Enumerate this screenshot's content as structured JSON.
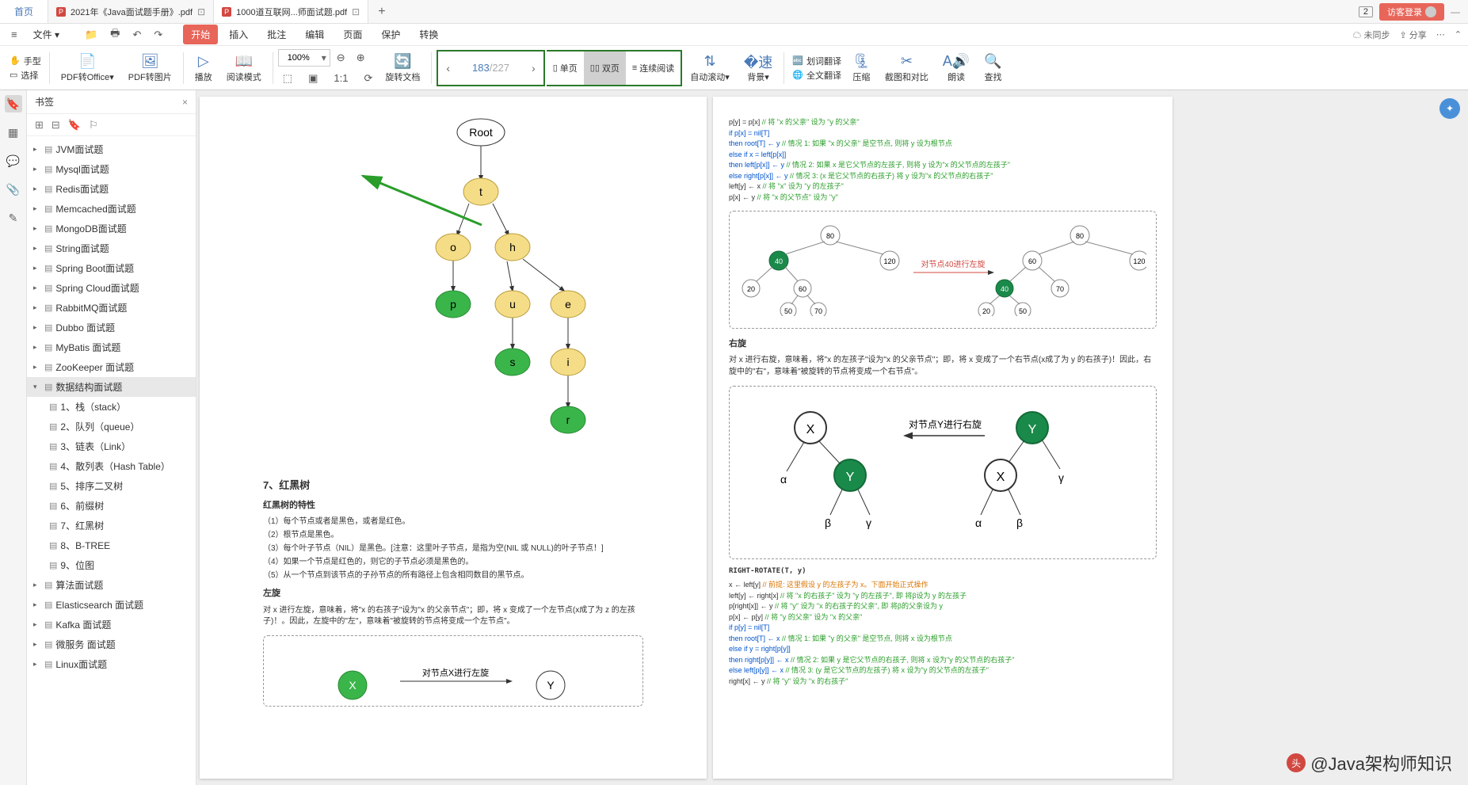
{
  "title_bar": {
    "home": "首页",
    "tabs": [
      {
        "label": "2021年《Java面试题手册》.pdf",
        "badge": "P"
      },
      {
        "label": "1000道互联网...师面试题.pdf",
        "badge": "P"
      }
    ],
    "badge_num": "2",
    "login": "访客登录"
  },
  "menu": {
    "file": "文件",
    "items": [
      "开始",
      "插入",
      "批注",
      "编辑",
      "页面",
      "保护",
      "转换"
    ],
    "right": {
      "unsync": "未同步",
      "share": "分享"
    }
  },
  "toolbar": {
    "hand": "手型",
    "select": "选择",
    "pdf_office": "PDF转Office",
    "pdf_img": "PDF转图片",
    "play": "播放",
    "read_mode": "阅读模式",
    "zoom": "100%",
    "rotate": "旋转文档",
    "page_cur": "183",
    "page_total": "/227",
    "single": "单页",
    "double": "双页",
    "continuous": "连续阅读",
    "auto_scroll": "自动滚动",
    "bg": "背景",
    "word_trans": "划词翻译",
    "full_trans": "全文翻译",
    "compress": "压缩",
    "screenshot": "截图和对比",
    "read_aloud": "朗读",
    "find": "查找"
  },
  "sidebar": {
    "title": "书签",
    "items": [
      {
        "label": "JVM面试题"
      },
      {
        "label": "Mysql面试题"
      },
      {
        "label": "Redis面试题"
      },
      {
        "label": "Memcached面试题"
      },
      {
        "label": "MongoDB面试题"
      },
      {
        "label": "String面试题"
      },
      {
        "label": "Spring Boot面试题"
      },
      {
        "label": "Spring Cloud面试题"
      },
      {
        "label": "RabbitMQ面试题"
      },
      {
        "label": "Dubbo 面试题"
      },
      {
        "label": "MyBatis 面试题"
      },
      {
        "label": "ZooKeeper 面试题"
      },
      {
        "label": "数据结构面试题",
        "selected": true,
        "expanded": true,
        "children": [
          "1、栈（stack）",
          "2、队列（queue）",
          "3、链表（Link）",
          "4、散列表（Hash Table）",
          "5、排序二叉树",
          "6、前缀树",
          "7、红黑树",
          "8、B-TREE",
          "9、位图"
        ]
      },
      {
        "label": "算法面试题"
      },
      {
        "label": "Elasticsearch 面试题"
      },
      {
        "label": "Kafka 面试题"
      },
      {
        "label": "微服务 面试题"
      },
      {
        "label": "Linux面试题"
      }
    ]
  },
  "left_page": {
    "tree": {
      "root": "Root",
      "nodes": [
        "t",
        "o",
        "h",
        "p",
        "u",
        "e",
        "s",
        "i",
        "r"
      ]
    },
    "section": "7、红黑树",
    "subtitle": "红黑树的特性",
    "lines": [
      "（1）每个节点或者是黑色，或者是红色。",
      "（2）根节点是黑色。",
      "（3）每个叶子节点（NIL）是黑色。[注意：这里叶子节点，是指为空(NIL 或 NULL)的叶子节点！]",
      "（4）如果一个节点是红色的，则它的子节点必须是黑色的。",
      "（5）从一个节点到该节点的子孙节点的所有路径上包含相同数目的黑节点。"
    ],
    "leftrot_title": "左旋",
    "leftrot_text": "对 x 进行左旋，意味着，将\"x 的右孩子\"设为\"x 的父亲节点\"；即，将 x 变成了一个左节点(x成了为 z 的左孩子)！。因此，左旋中的\"左\"，意味着\"被旋转的节点将变成一个左节点\"。",
    "leftrot_diag": "对节点X进行左旋"
  },
  "right_page": {
    "code1": [
      {
        "t": "p[y] = p[x]",
        "c": ""
      },
      {
        "t": " // 将 \"x 的父亲\" 设为 \"y 的父亲\"",
        "c": "kw-green"
      },
      {
        "t": "if p[x] = nil[T]",
        "c": "kw-blue"
      },
      {
        "t": "then root[T] ← y",
        "c": "kw-blue"
      },
      {
        "t": " // 情况 1: 如果 \"x 的父亲\" 是空节点, 则将 y 设为根节点",
        "c": "kw-green"
      },
      {
        "t": "else if x = left[p[x]]",
        "c": "kw-blue"
      },
      {
        "t": "then left[p[x]] ← y",
        "c": "kw-blue"
      },
      {
        "t": " // 情况 2: 如果 x 是它父节点的左孩子, 则将 y 设为\"x 的父节点的左孩子\"",
        "c": "kw-green"
      },
      {
        "t": "else right[p[x]] ← y",
        "c": "kw-blue"
      },
      {
        "t": " // 情况 3: (x 是它父节点的右孩子) 将 y 设为\"x 的父节点的右孩子\"",
        "c": "kw-green"
      },
      {
        "t": "left[y] ← x",
        "c": ""
      },
      {
        "t": " // 将 \"x\" 设为 \"y 的左孩子\"",
        "c": "kw-green"
      },
      {
        "t": "p[x] ← y",
        "c": ""
      },
      {
        "t": " // 将 \"x 的父节点\" 设为 \"y\"",
        "c": "kw-green"
      }
    ],
    "bst_label": "对节点40进行左旋",
    "rightrot_title": "右旋",
    "rightrot_text": "对 x 进行右旋，意味着，将\"x 的左孩子\"设为\"x 的父亲节点\"；即，将 x 变成了一个右节点(x成了为 y 的右孩子)！因此，右旋中的\"右\"，意味着\"被旋转的节点将变成一个右节点\"。",
    "rightrot_diag": "对节点Y进行右旋",
    "code2_title": "RIGHT-ROTATE(T, y)",
    "code2": [
      {
        "t": "x ← left[y]",
        "c": ""
      },
      {
        "t": " // 前提: 这里假设 y 的左孩子为 x。下面开始正式操作",
        "c": "kw-orange"
      },
      {
        "t": "left[y] ← right[x]",
        "c": ""
      },
      {
        "t": " // 将 \"x 的右孩子\" 设为 \"y 的左孩子\", 即 将β设为 y 的左孩子",
        "c": "kw-green"
      },
      {
        "t": "p[right[x]] ← y",
        "c": ""
      },
      {
        "t": " // 将 \"y\" 设为 \"x 的右孩子的父亲\", 即 将β的父亲设为 y",
        "c": "kw-green"
      },
      {
        "t": "p[x] ← p[y]",
        "c": ""
      },
      {
        "t": " // 将 \"y 的父亲\" 设为 \"x 的父亲\"",
        "c": "kw-green"
      },
      {
        "t": "if p[y] = nil[T]",
        "c": "kw-blue"
      },
      {
        "t": "then root[T] ← x",
        "c": "kw-blue"
      },
      {
        "t": " // 情况 1: 如果 \"y 的父亲\" 是空节点, 则将 x 设为根节点",
        "c": "kw-green"
      },
      {
        "t": "else if y = right[p[y]]",
        "c": "kw-blue"
      },
      {
        "t": "then right[p[y]] ← x",
        "c": "kw-blue"
      },
      {
        "t": " // 情况 2: 如果 y 是它父节点的右孩子, 则将 x 设为\"y 的父节点的右孩子\"",
        "c": "kw-green"
      },
      {
        "t": "else left[p[y]] ← x",
        "c": "kw-blue"
      },
      {
        "t": " // 情况 3: (y 是它父节点的左孩子) 将 x 设为\"y 的父节点的左孩子\"",
        "c": "kw-green"
      },
      {
        "t": "right[x] ← y",
        "c": ""
      },
      {
        "t": " // 将 \"y\" 设为 \"x 的右孩子\"",
        "c": "kw-green"
      }
    ]
  },
  "watermark": "@Java架构师知识"
}
